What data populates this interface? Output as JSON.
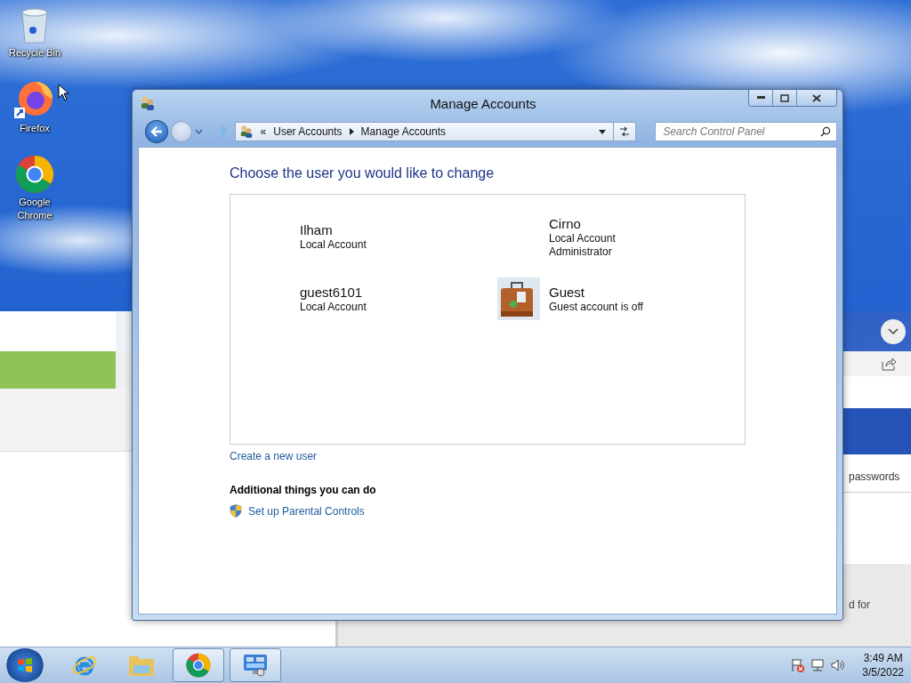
{
  "desktop": {
    "icons": [
      {
        "kind": "recycle",
        "label": "Recycle Bin"
      },
      {
        "kind": "firefox",
        "label": "Firefox"
      },
      {
        "kind": "chrome",
        "label": "Google Chrome"
      }
    ]
  },
  "background_window": {
    "texts": [
      "passwords",
      "d for"
    ]
  },
  "window": {
    "title": "Manage Accounts",
    "breadcrumb": {
      "prefix": "«",
      "items": [
        "User Accounts",
        "Manage Accounts"
      ]
    },
    "search": {
      "placeholder": "Search Control Panel"
    }
  },
  "heading": "Choose the user you would like to change",
  "accounts": [
    {
      "name": "Ilham",
      "details": [
        "Local Account"
      ],
      "kind": "none"
    },
    {
      "name": "Cirno",
      "details": [
        "Local Account",
        "Administrator"
      ],
      "kind": "none"
    },
    {
      "name": "guest6101",
      "details": [
        "Local Account"
      ],
      "kind": "none"
    },
    {
      "name": "Guest",
      "details": [
        "Guest account is off"
      ],
      "kind": "suitcase"
    }
  ],
  "create_link": "Create a new user",
  "additional": {
    "heading": "Additional things you can do",
    "links": [
      "Set up Parental Controls"
    ]
  },
  "taskbar": {
    "apps": [
      {
        "kind": "ie",
        "running": false
      },
      {
        "kind": "folder",
        "running": false
      },
      {
        "kind": "chrome",
        "running": true
      },
      {
        "kind": "control-panel",
        "running": true
      }
    ],
    "clock": {
      "time": "3:49 AM",
      "date": "3/5/2022"
    }
  }
}
